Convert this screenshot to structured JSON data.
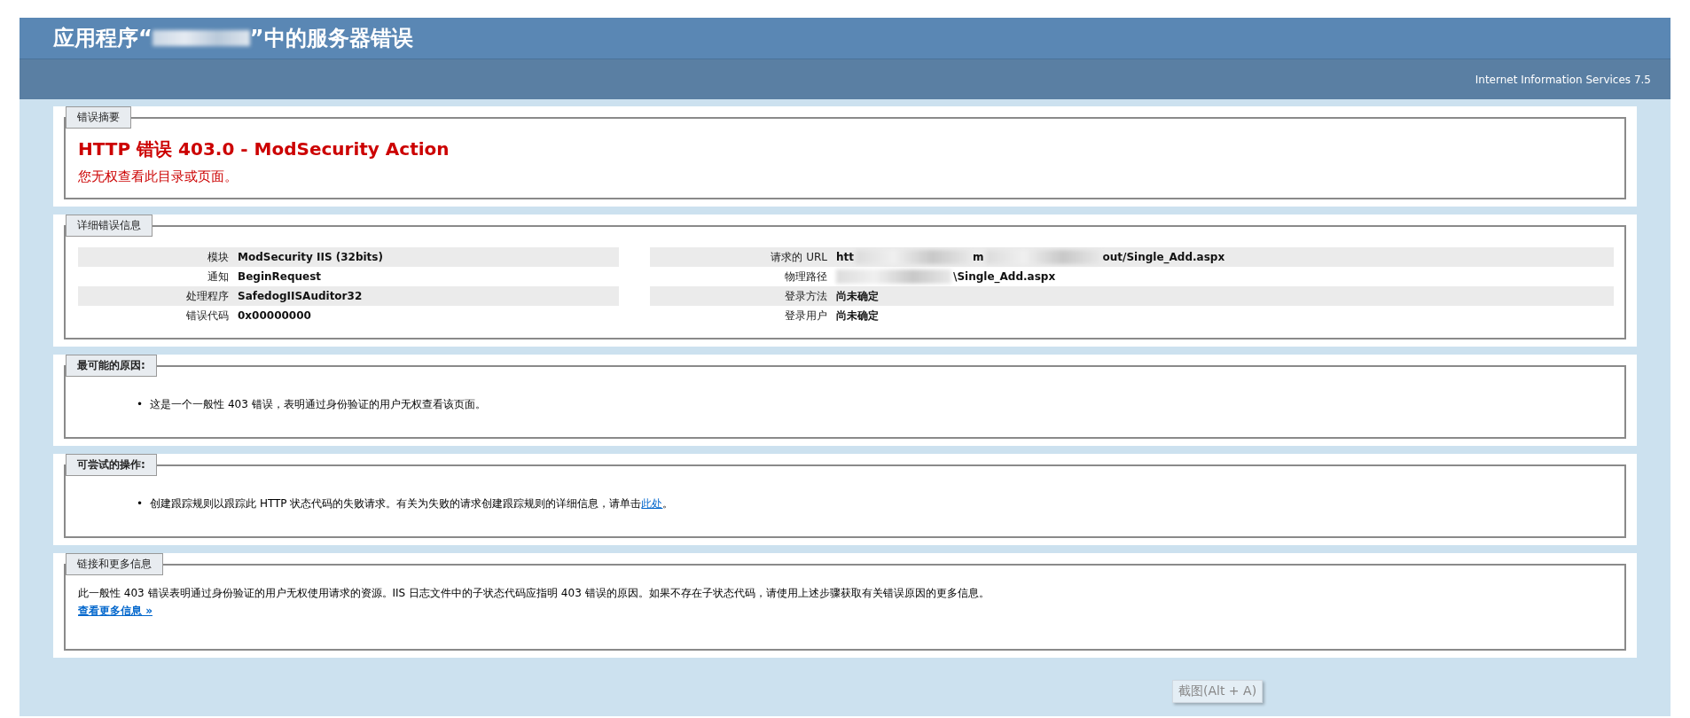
{
  "header": {
    "title_parts": [
      "应用程序“",
      "”中的服务器错误"
    ],
    "server": "Internet Information Services 7.5"
  },
  "summary": {
    "legend": "错误摘要",
    "heading": "HTTP 错误 403.0 - ModSecurity Action",
    "message": "您无权查看此目录或页面。"
  },
  "details": {
    "legend": "详细错误信息",
    "left": [
      {
        "label": "模块",
        "value_parts": [
          {
            "kind": "text",
            "text": "ModSecurity IIS (32bits)"
          }
        ]
      },
      {
        "label": "通知",
        "value_parts": [
          {
            "kind": "text",
            "text": "BeginRequest"
          }
        ]
      },
      {
        "label": "处理程序",
        "value_parts": [
          {
            "kind": "text",
            "text": "SafedogIISAuditor32"
          }
        ]
      },
      {
        "label": "错误代码",
        "value_parts": [
          {
            "kind": "text",
            "text": "0x00000000"
          }
        ]
      }
    ],
    "right": [
      {
        "label": "请求的 URL",
        "value_parts": [
          {
            "kind": "text",
            "text": "htt"
          },
          {
            "kind": "redacted"
          },
          {
            "kind": "text",
            "text": "m"
          },
          {
            "kind": "redacted"
          },
          {
            "kind": "text",
            "text": "out/Single_Add.aspx"
          }
        ]
      },
      {
        "label": "物理路径",
        "value_parts": [
          {
            "kind": "redacted"
          },
          {
            "kind": "text",
            "text": "\\Single_Add.aspx"
          }
        ]
      },
      {
        "label": "登录方法",
        "value_parts": [
          {
            "kind": "text",
            "text": "尚未确定"
          }
        ]
      },
      {
        "label": "登录用户",
        "value_parts": [
          {
            "kind": "text",
            "text": "尚未确定"
          }
        ]
      }
    ]
  },
  "causes": {
    "legend": "最可能的原因:",
    "items": [
      {
        "bullet": "•",
        "text": "这是一个一般性 403 错误，表明通过身份验证的用户无权查看该页面。"
      }
    ]
  },
  "actions": {
    "legend": "可尝试的操作:",
    "items": [
      {
        "bullet": "•",
        "text": "创建跟踪规则以跟踪此 HTTP 状态代码的失败请求。有关为失败的请求创建跟踪规则的详细信息，请单击",
        "link": "此处",
        "after": "。"
      }
    ]
  },
  "more": {
    "legend": "链接和更多信息",
    "text": "此一般性 403 错误表明通过身份验证的用户无权使用请求的资源。IIS 日志文件中的子状态代码应指明 403 错误的原因。如果不存在子状态代码，请使用上述步骤获取有关错误原因的更多信息。",
    "link": "查看更多信息 »"
  },
  "screenshot_tip": "截图(Alt + A)"
}
